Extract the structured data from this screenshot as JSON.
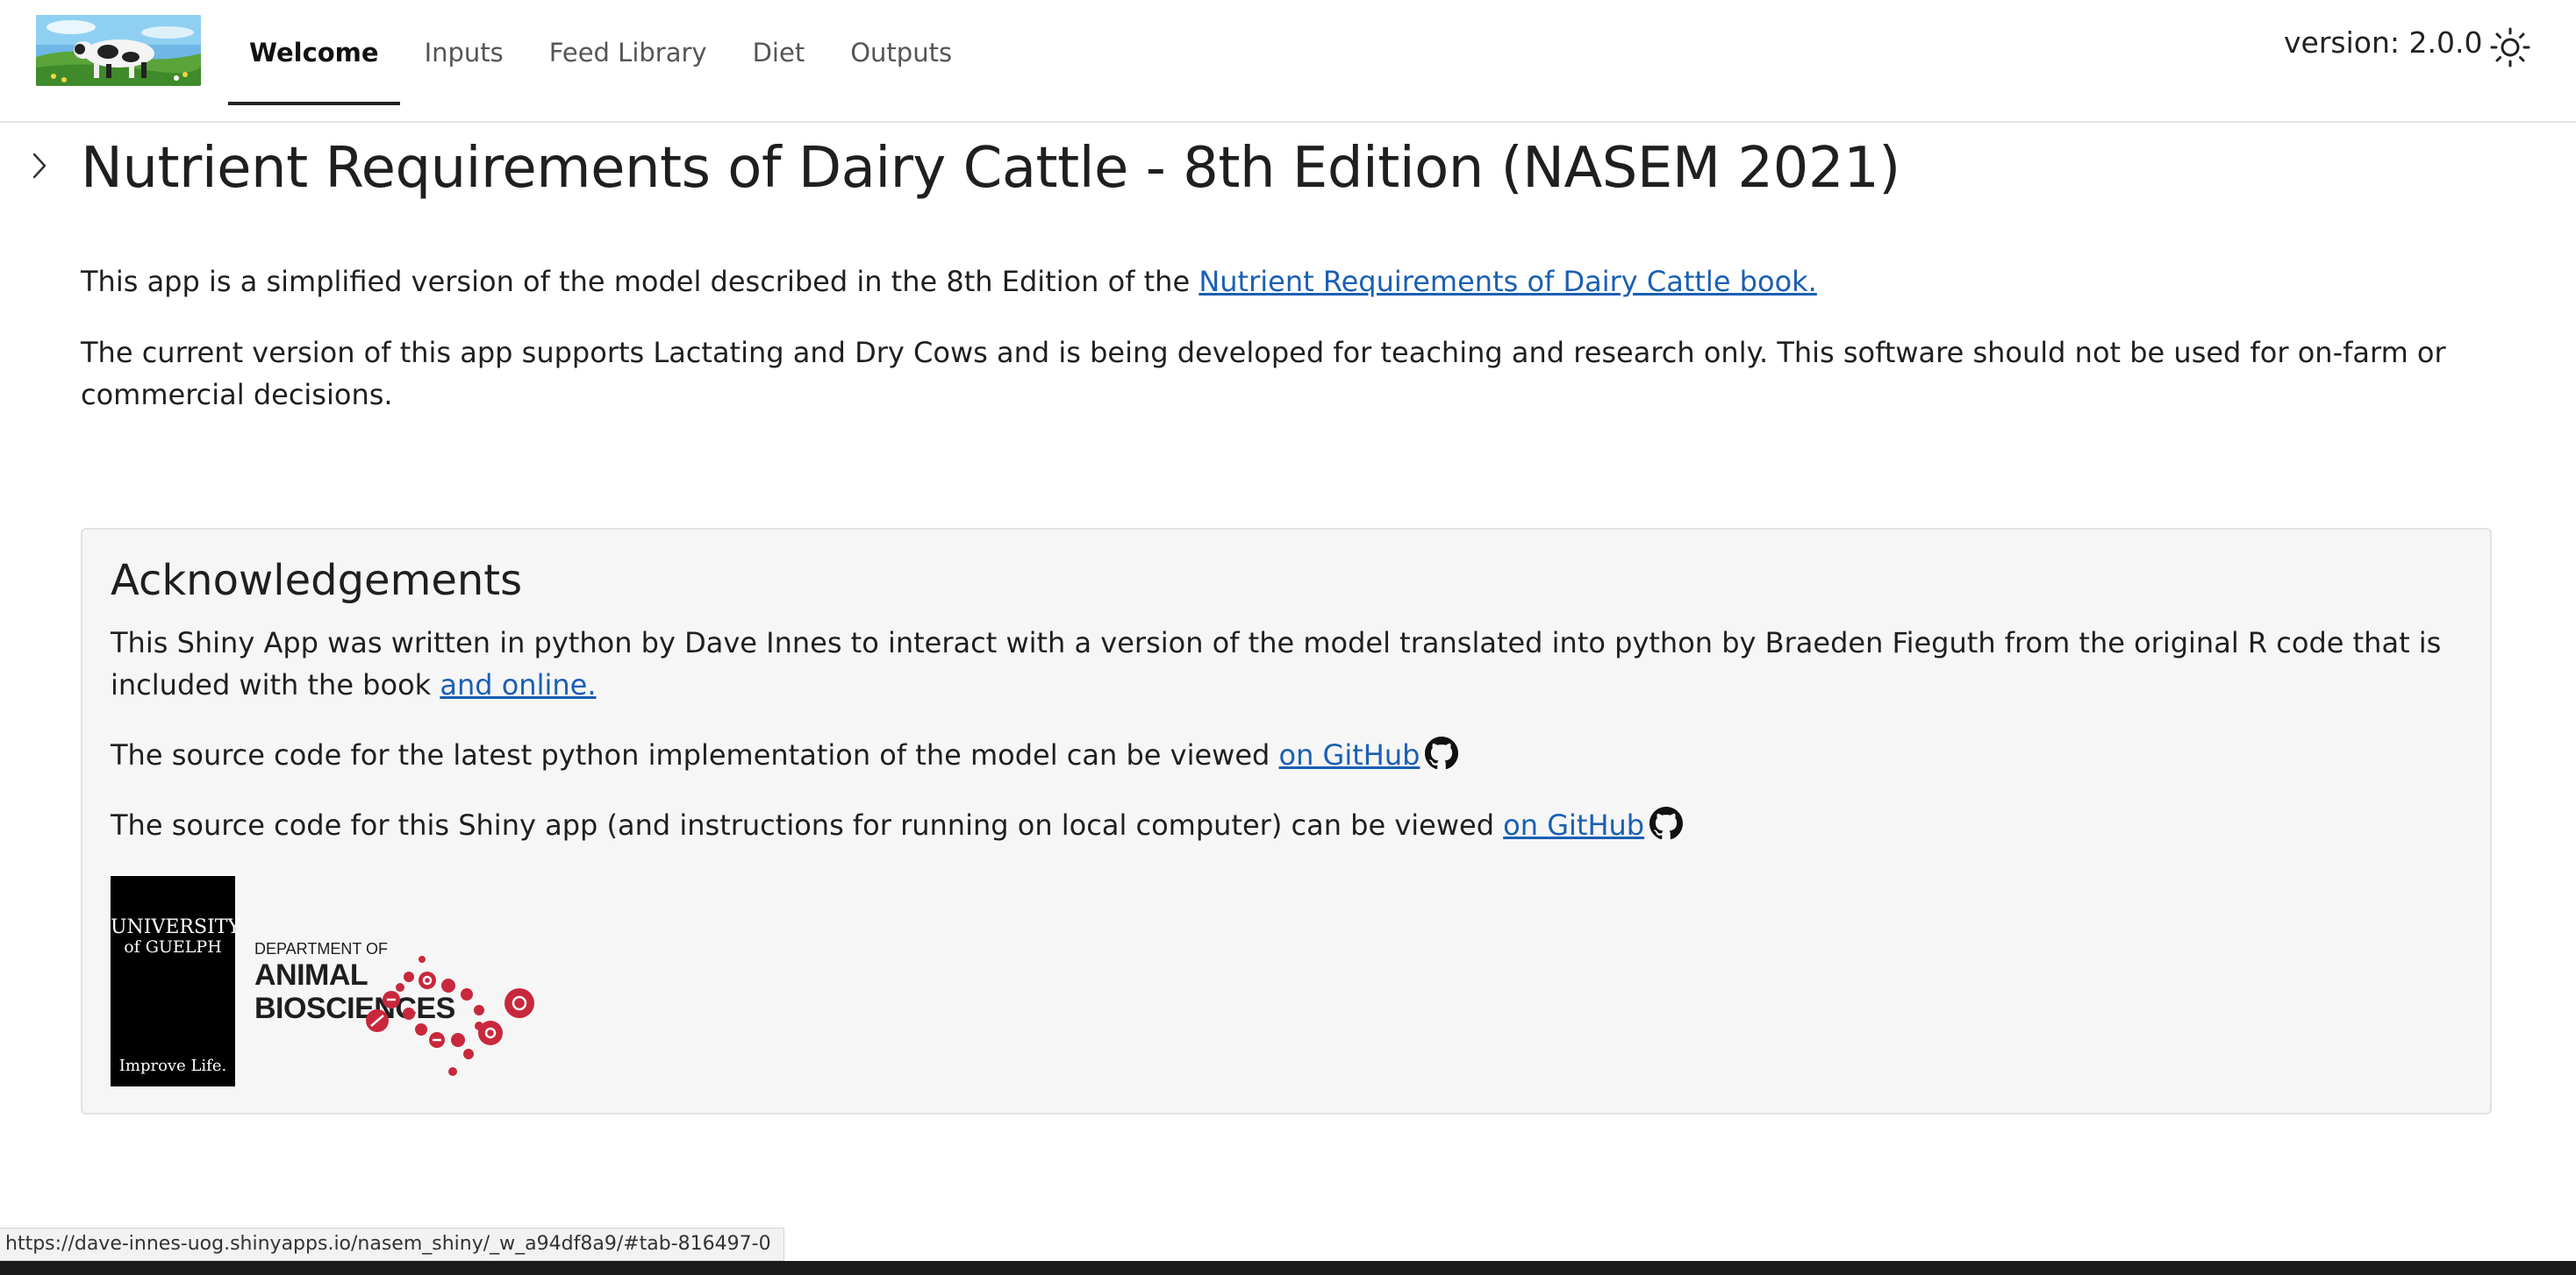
{
  "navbar": {
    "tabs": [
      "Welcome",
      "Inputs",
      "Feed Library",
      "Diet",
      "Outputs"
    ],
    "active_tab": "Welcome",
    "version": "version: 2.0.0"
  },
  "main": {
    "title": "Nutrient Requirements of Dairy Cattle - 8th Edition (NASEM 2021)",
    "intro_text": "This app is a simplified version of the model described in the 8th Edition of the ",
    "intro_link": "Nutrient Requirements of Dairy Cattle book.",
    "notice": "The current version of this app supports Lactating and Dry Cows and is being developed for teaching and research only. This software should not be used for on-farm or commercial decisions."
  },
  "acknowledgements": {
    "title": "Acknowledgements",
    "para1_text": "This Shiny App was written in python by Dave Innes to interact with a version of the model translated into python by Braeden Fieguth from the original R code that is included with the book ",
    "para1_link": "and online.",
    "para2_text": "The source code for the latest python implementation of the model can be viewed ",
    "para2_link": "on GitHub",
    "para3_text": "The source code for this Shiny app (and instructions for running on local computer) can be viewed ",
    "para3_link": "on GitHub",
    "uog_logo": {
      "name_line1": "UNIVERSITY",
      "name_line2": "of GUELPH",
      "motto": "Improve Life."
    },
    "dept_logo": {
      "line1": "DEPARTMENT OF",
      "line2": "ANIMAL",
      "line3": "BIOSCIENCES"
    }
  },
  "status_url": "https://dave-innes-uog.shinyapps.io/nasem_shiny/_w_a94df8a9/#tab-816497-0",
  "icons": {
    "theme_toggle": "sun-icon",
    "sidebar_toggle": "chevron-right-icon",
    "github": "github-icon"
  },
  "colors": {
    "link": "#1a5fb4",
    "dept_accent": "#c8283c"
  }
}
